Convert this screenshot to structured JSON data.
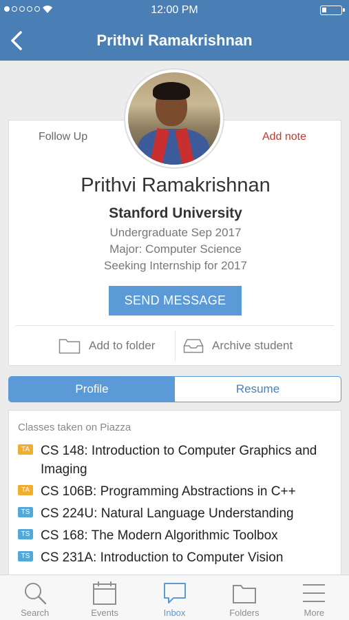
{
  "status_bar": {
    "time": "12:00 PM"
  },
  "nav": {
    "title": "Prithvi Ramakrishnan"
  },
  "profile": {
    "follow_up": "Follow Up",
    "add_note": "Add note",
    "name": "Prithvi Ramakrishnan",
    "school": "Stanford University",
    "lines": [
      "Undergraduate Sep 2017",
      "Major: Computer Science",
      "Seeking Internship for 2017"
    ],
    "send_message": "SEND MESSAGE",
    "add_to_folder": "Add to folder",
    "archive_student": "Archive student"
  },
  "segments": {
    "profile": "Profile",
    "resume": "Resume",
    "active": "Profile"
  },
  "classes": {
    "title": "Classes taken on Piazza",
    "items": [
      {
        "badge": "TA",
        "text": "CS 148: Introduction to Computer Graphics and Imaging"
      },
      {
        "badge": "TA",
        "text": "CS 106B: Programming Abstractions in C++"
      },
      {
        "badge": "TS",
        "text": "CS 224U: Natural Language Understanding"
      },
      {
        "badge": "TS",
        "text": "CS 168: The Modern Algorithmic Toolbox"
      },
      {
        "badge": "TS",
        "text": "CS 231A: Introduction to Computer Vision"
      }
    ]
  },
  "tabs": [
    {
      "label": "Search",
      "icon": "search-icon"
    },
    {
      "label": "Events",
      "icon": "calendar-icon"
    },
    {
      "label": "Inbox",
      "icon": "chat-bubble-icon",
      "active": true
    },
    {
      "label": "Folders",
      "icon": "folder-icon"
    },
    {
      "label": "More",
      "icon": "menu-icon"
    }
  ],
  "colors": {
    "header": "#4a7fb5",
    "accent": "#5b9ad6",
    "note": "#c0392b",
    "ta_badge": "#f0ad2f",
    "ts_badge": "#52a8d8"
  }
}
